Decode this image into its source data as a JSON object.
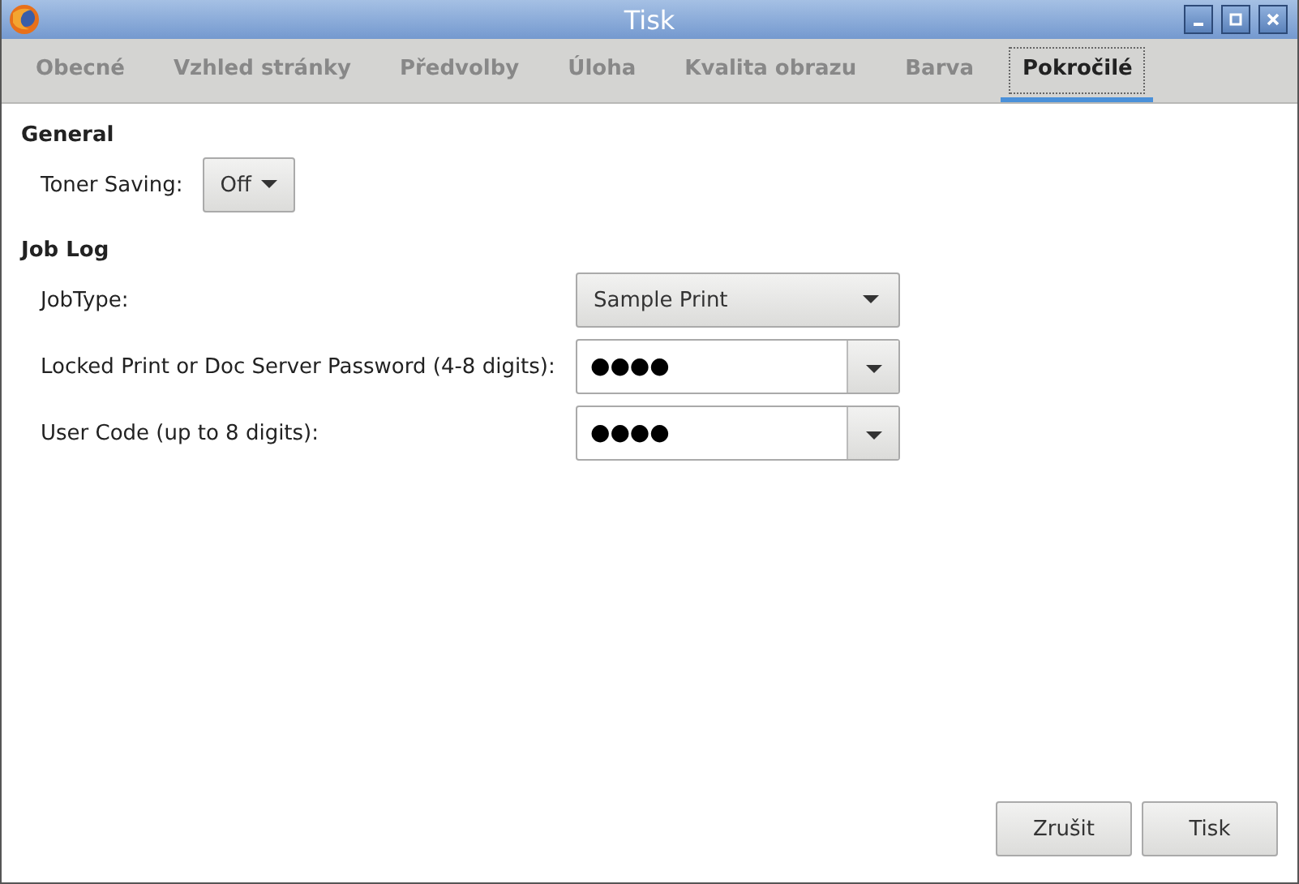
{
  "window": {
    "title": "Tisk"
  },
  "tabs": [
    {
      "label": "Obecné",
      "selected": false
    },
    {
      "label": "Vzhled stránky",
      "selected": false
    },
    {
      "label": "Předvolby",
      "selected": false
    },
    {
      "label": "Úloha",
      "selected": false
    },
    {
      "label": "Kvalita obrazu",
      "selected": false
    },
    {
      "label": "Barva",
      "selected": false
    },
    {
      "label": "Pokročilé",
      "selected": true
    }
  ],
  "sections": [
    {
      "title": "General",
      "rows": [
        {
          "kind": "button",
          "label": "Toner Saving:",
          "value": "Off"
        }
      ]
    },
    {
      "title": "Job Log",
      "rows": [
        {
          "kind": "combo",
          "label": "JobType:",
          "value": "Sample Print"
        },
        {
          "kind": "entry",
          "label": "Locked Print or Doc Server Password (4-8 digits):",
          "value": "●●●●"
        },
        {
          "kind": "entry",
          "label": "User Code (up to 8 digits):",
          "value": "●●●●"
        }
      ]
    }
  ],
  "buttons": [
    "Zrušit",
    "Tisk"
  ]
}
